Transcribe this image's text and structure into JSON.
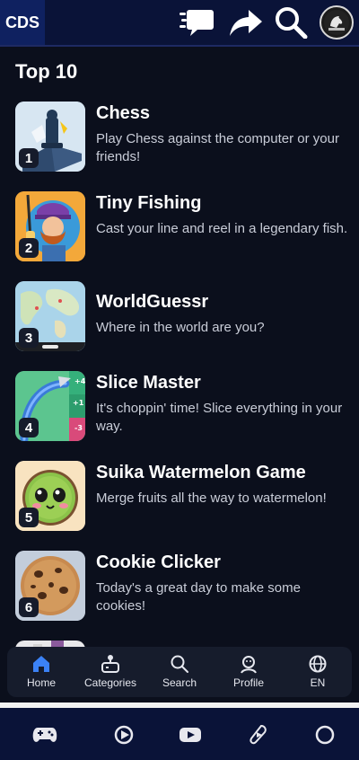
{
  "header": {
    "logo_text": "CDS",
    "icons": [
      "chat-icon",
      "share-icon",
      "search-icon",
      "avatar-icon"
    ]
  },
  "section": {
    "title": "Top 10"
  },
  "games": [
    {
      "rank": "1",
      "title": "Chess",
      "description": "Play Chess against the computer or your friends!"
    },
    {
      "rank": "2",
      "title": "Tiny Fishing",
      "description": "Cast your line and reel in a legendary fish."
    },
    {
      "rank": "3",
      "title": "WorldGuessr",
      "description": "Where in the world are you?"
    },
    {
      "rank": "4",
      "title": "Slice Master",
      "description": "It's choppin' time! Slice everything in your way."
    },
    {
      "rank": "5",
      "title": "Suika Watermelon Game",
      "description": "Merge fruits all the way to watermelon!"
    },
    {
      "rank": "6",
      "title": "Cookie Clicker",
      "description": "Today's a great day to make some cookies!"
    }
  ],
  "bottom_nav": [
    {
      "label": "Home",
      "icon": "home-icon",
      "active": true
    },
    {
      "label": "Categories",
      "icon": "gamepad-icon",
      "active": false
    },
    {
      "label": "Search",
      "icon": "search-icon",
      "active": false
    },
    {
      "label": "Profile",
      "icon": "profile-icon",
      "active": false
    },
    {
      "label": "EN",
      "icon": "globe-icon",
      "active": false
    }
  ],
  "system_bar": {
    "icons": [
      "gamepad-icon",
      "play-circle-icon",
      "youtube-icon",
      "shorts-icon",
      "home-circle-icon"
    ]
  },
  "colors": {
    "background": "#0b0f1c",
    "topbar": "#0a1338",
    "nav_active": "#3b82f6"
  }
}
